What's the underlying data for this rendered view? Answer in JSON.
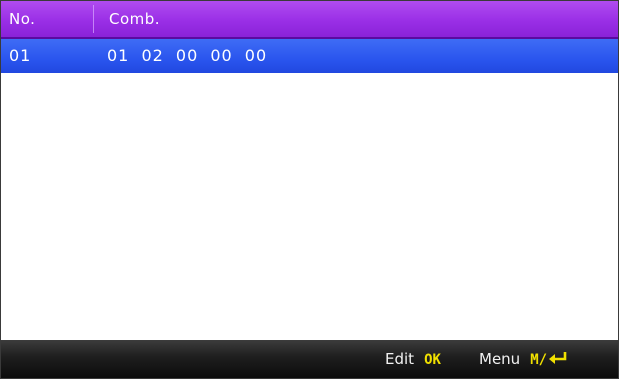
{
  "table": {
    "columns": [
      "No.",
      "Comb."
    ],
    "rows": [
      {
        "no": "01",
        "comb": "01 02 00 00 00",
        "selected": true
      }
    ]
  },
  "footer": {
    "edit_label": "Edit",
    "edit_key": "OK",
    "menu_label": "Menu",
    "menu_key": "M/",
    "menu_key_icon": "enter-arrow-icon"
  },
  "colors": {
    "header": "#9a2fe6",
    "selected_row": "#2a55ee",
    "footer": "#1e1e1e",
    "key_text": "#f0e000"
  }
}
